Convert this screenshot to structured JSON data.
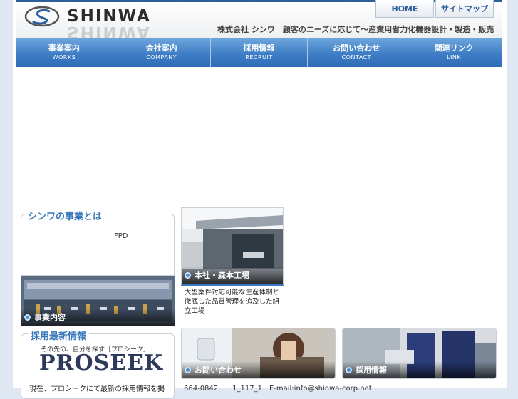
{
  "header": {
    "brand_text": "SHINWA",
    "tagline": "株式会社 シンワ　顧客のニーズに応じて〜産業用省力化機器設計・製造・販売",
    "home_link": "HOME",
    "sitemap_link": "サイトマップ"
  },
  "nav": {
    "items": [
      {
        "jp": "事業案内",
        "en": "WORKS"
      },
      {
        "jp": "会社案内",
        "en": "COMPANY"
      },
      {
        "jp": "採用情報",
        "en": "RECRUIT"
      },
      {
        "jp": "お問い合わせ",
        "en": "CONTACT"
      },
      {
        "jp": "関連リンク",
        "en": "LINK"
      }
    ]
  },
  "about": {
    "title": "シンワの事業とは",
    "body": "FPD",
    "photo_caption": "事業内容"
  },
  "factory": {
    "photo_caption": "本社・森本工場",
    "description": "大型案件対応可能な生産体制と徹底した品質管理を追及した組立工場"
  },
  "recruit_news": {
    "title": "採用最新情報",
    "proseek_tagline": "その先の、自分を探す［プロシーク］",
    "proseek_logo": "PROSEEK",
    "body_start": "現在、プロシークにて最新の採用情報を掲"
  },
  "contact_banner": {
    "caption": "お問い合わせ"
  },
  "recruit_banner": {
    "caption": "採用情報"
  },
  "footer": {
    "text": "664-0842　　1_117_1　E-mail:info@shinwa-corp.net"
  }
}
